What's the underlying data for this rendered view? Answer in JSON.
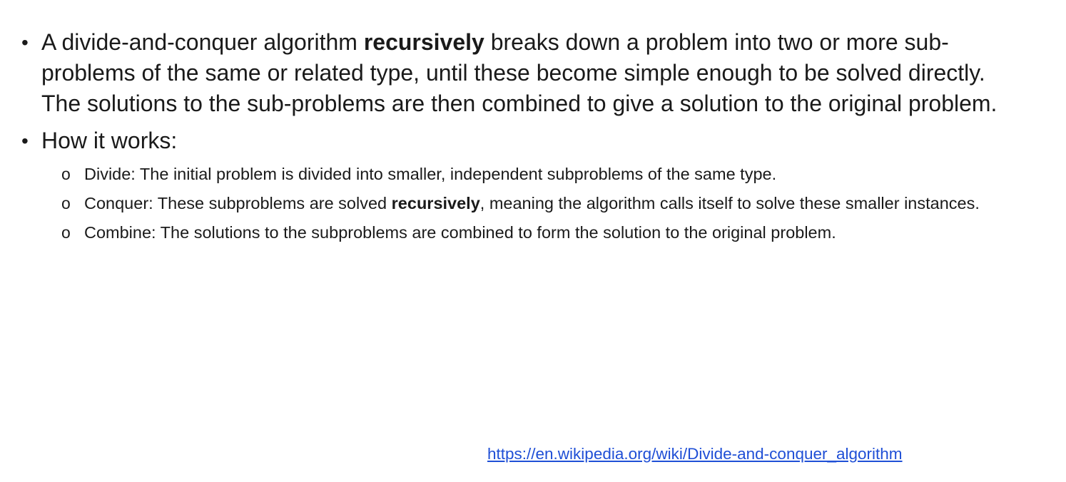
{
  "bullets": {
    "definition": {
      "before": "A divide-and-conquer algorithm ",
      "emphasis": "recursively",
      "after": " breaks down a problem into two or more sub-problems of the same or related type, until these become simple enough to be solved directly. The solutions to the sub-problems are then combined to give a solution to the original problem."
    },
    "how_it_works": {
      "label": "How it works:",
      "steps": {
        "divide": {
          "text": "Divide: The initial problem is divided into smaller, independent subproblems of the same type."
        },
        "conquer": {
          "before": "Conquer: These subproblems are solved ",
          "emphasis": "recursively",
          "after": ", meaning the algorithm calls itself to solve these smaller instances."
        },
        "combine": {
          "text": "Combine: The solutions to the subproblems are combined to form the solution to the original problem."
        }
      }
    }
  },
  "markers": {
    "level1": "•",
    "level2": "o"
  },
  "reference": {
    "url_text": "https://en.wikipedia.org/wiki/Divide-and-conquer_algorithm"
  },
  "colors": {
    "text": "#1a1a1a",
    "link": "#1f4fd6",
    "background": "#ffffff"
  }
}
